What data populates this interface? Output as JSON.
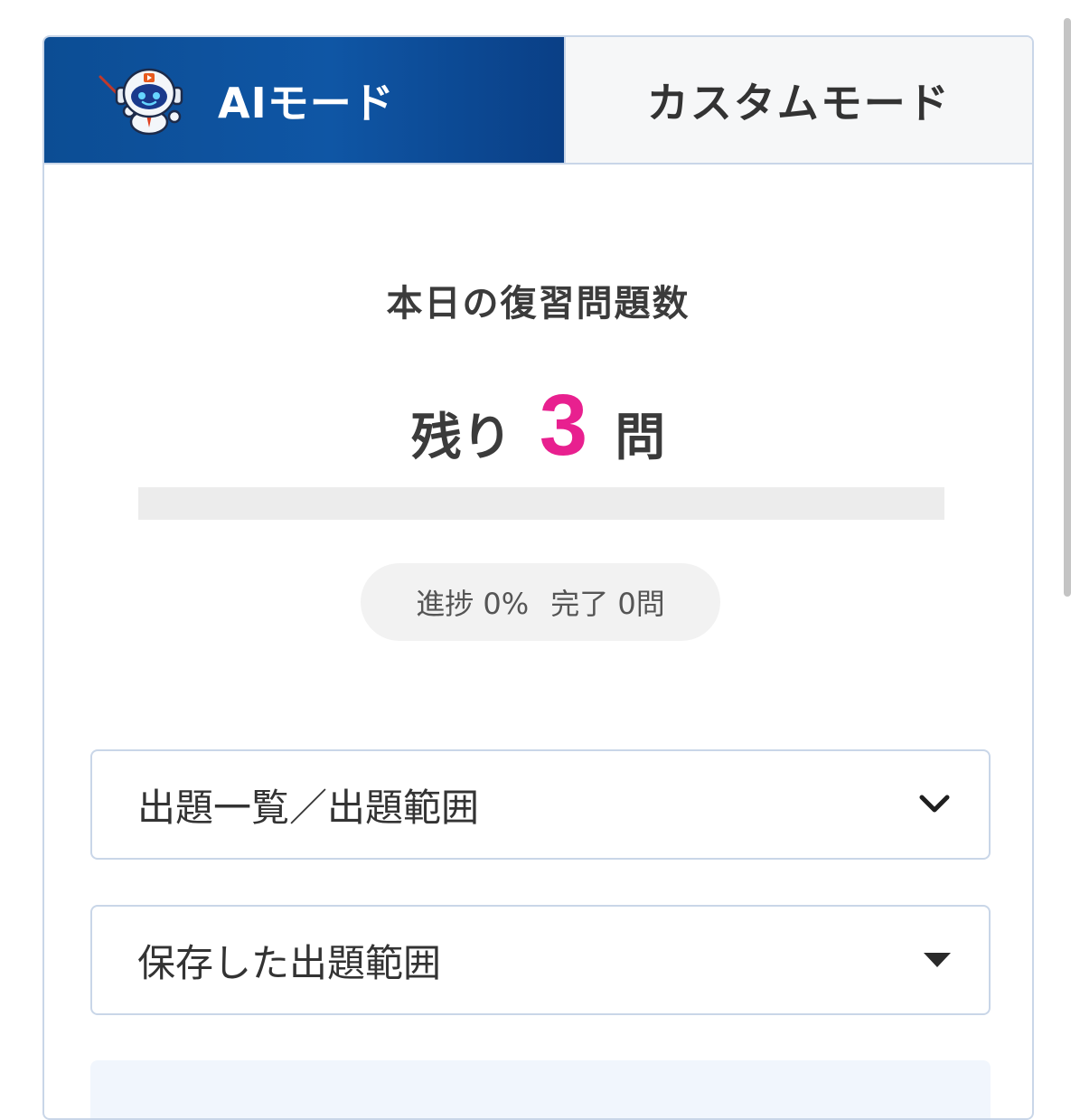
{
  "tabs": {
    "ai_label": "AIモード",
    "custom_label": "カスタムモード",
    "active": "ai"
  },
  "review": {
    "title": "本日の復習問題数",
    "remaining_prefix": "残り",
    "remaining_count": "3",
    "remaining_suffix": "問",
    "progress_fraction": 0,
    "progress_text": "進捗 0%",
    "completed_text": "完了 0問"
  },
  "selects": {
    "question_list_label": "出題一覧／出題範囲",
    "saved_range_label": "保存した出題範囲"
  },
  "icons": {
    "ai_tab": "robot-mascot-icon",
    "question_list": "chevron-down-icon",
    "saved_range": "caret-down-icon"
  },
  "colors": {
    "accent": "#e8208f",
    "tab_active_bg": "#0f56a5",
    "border": "#c9d6e8"
  }
}
